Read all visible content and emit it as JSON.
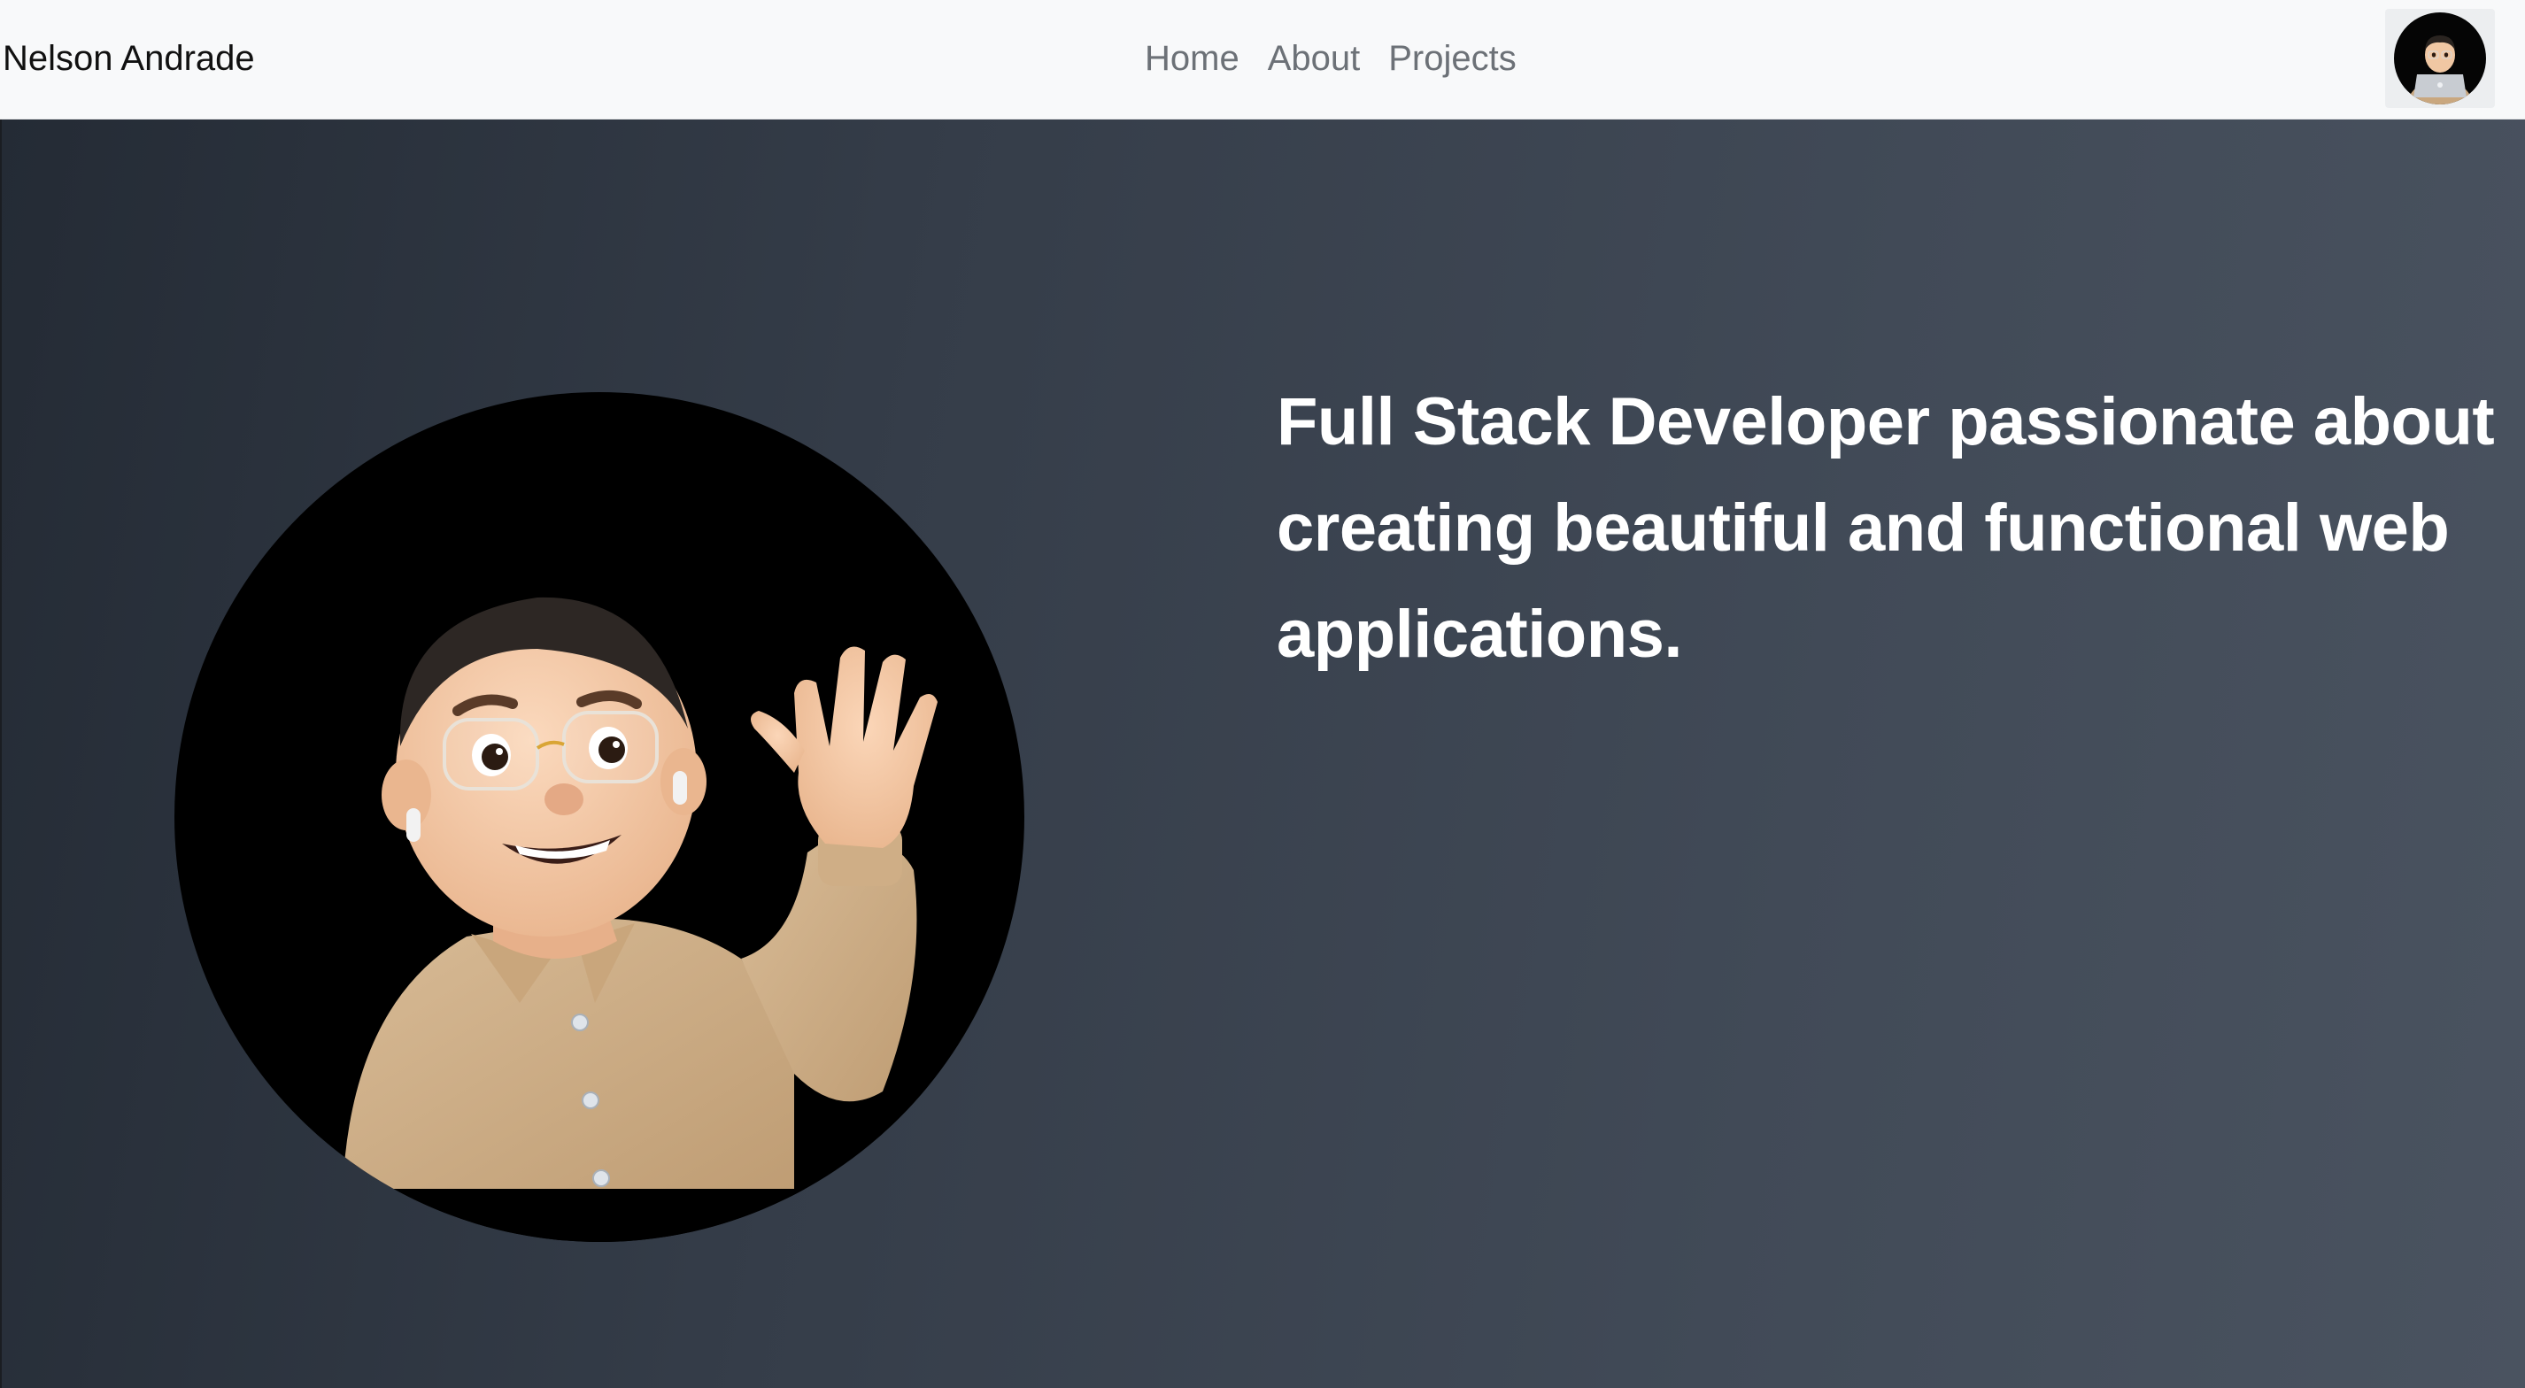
{
  "navbar": {
    "brand": "Nelson Andrade",
    "links": [
      {
        "label": "Home"
      },
      {
        "label": "About"
      },
      {
        "label": "Projects"
      }
    ],
    "avatar_icon": "memoji-laptop-avatar-icon"
  },
  "hero": {
    "tagline": "Full Stack Developer passionate about creating beautiful and functional web applications.",
    "portrait_icon": "waving-memoji-portrait"
  },
  "colors": {
    "navbar_bg": "#f8f9fa",
    "hero_gradient_start": "#242b35",
    "hero_gradient_end": "#4a5360",
    "text_light": "#ffffff",
    "nav_link": "#6c7177"
  }
}
